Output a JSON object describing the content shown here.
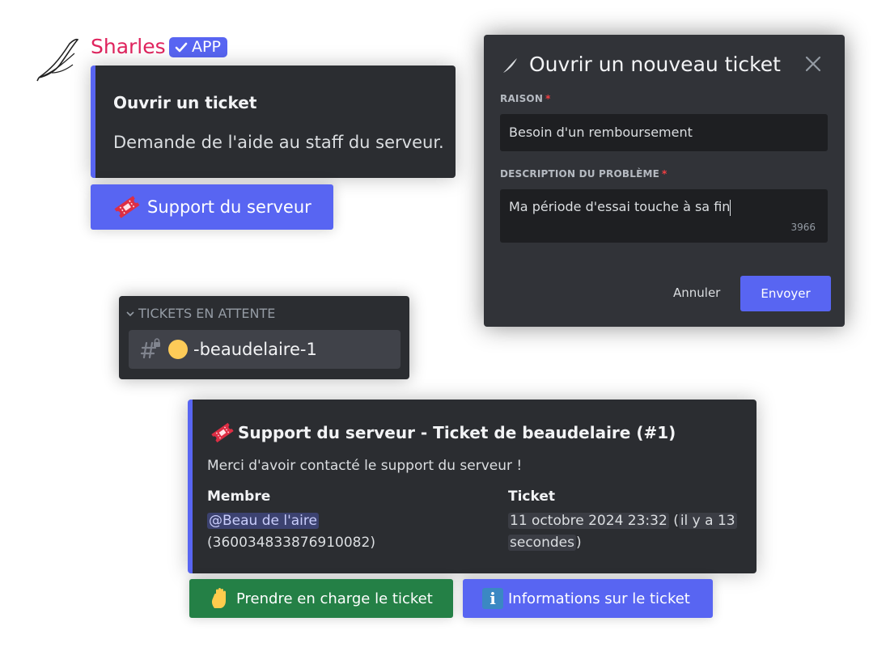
{
  "bot": {
    "name": "Sharles",
    "badge": "APP",
    "name_color": "#e0245e"
  },
  "embed_open_ticket": {
    "title": "Ouvrir un ticket",
    "description": "Demande de l'aide au staff du serveur.",
    "accent_color": "#5865f2"
  },
  "support_button": {
    "icon": "ticket-icon",
    "label": "Support du serveur"
  },
  "modal": {
    "title": "Ouvrir un nouveau ticket",
    "title_icon": "feather-icon",
    "fields": [
      {
        "label": "RAISON",
        "required_mark": "*",
        "value": "Besoin d'un remboursement"
      },
      {
        "label": "DESCRIPTION DU PROBLÈME",
        "required_mark": "*",
        "value": "Ma période d'essai touche à sa fin",
        "char_count": "3966"
      }
    ],
    "cancel_label": "Annuler",
    "submit_label": "Envoyer"
  },
  "channels": {
    "category": "TICKETS EN ATTENTE",
    "items": [
      {
        "icon": "locked-hash-icon",
        "emoji": "yellow-circle",
        "name": "-beaudelaire-1"
      }
    ]
  },
  "embed_ticket": {
    "icon": "ticket-icon",
    "title": "Support du serveur - Ticket de beaudelaire (#1)",
    "description": "Merci d'avoir contacté le support du serveur !",
    "fields": {
      "member_name": "Membre",
      "member_mention": "@Beau de l'aire",
      "member_id": "(360034833876910082)",
      "ticket_name": "Ticket",
      "ticket_date": "11 octobre 2024 23:32",
      "ticket_relative_open": "(",
      "ticket_relative_1": "il y a 13",
      "ticket_relative_2": "secondes",
      "ticket_relative_close": ")"
    }
  },
  "buttons": {
    "claim": {
      "icon": "raised-hand-icon",
      "label": "Prendre en charge le ticket",
      "color": "#248046"
    },
    "info": {
      "icon": "info-icon",
      "glyph": "i",
      "label": "Informations sur le ticket",
      "color": "#5865f2"
    }
  }
}
